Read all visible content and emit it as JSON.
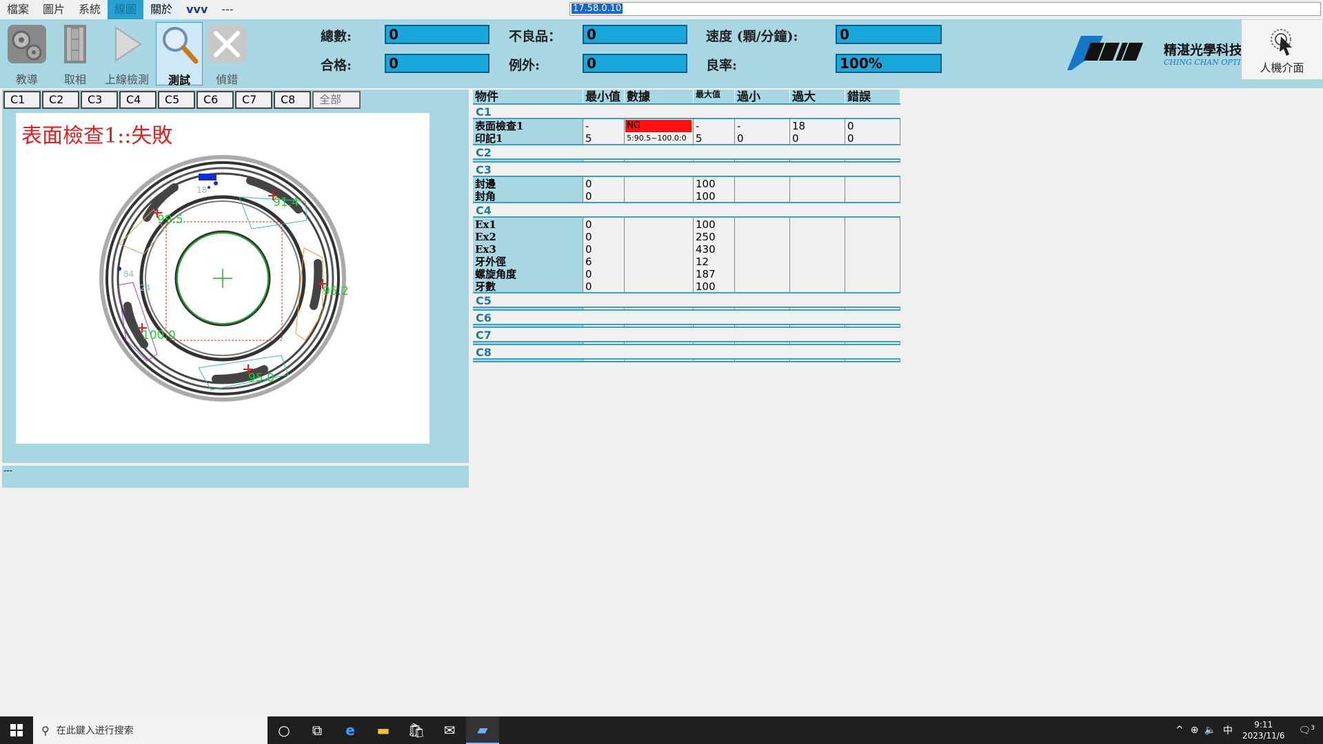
{
  "menu": {
    "items": [
      "檔案",
      "圖片",
      "系統",
      "線圖",
      "關於",
      "vvv",
      "---"
    ],
    "ip_value": "17.58.0.10"
  },
  "toolbar": {
    "buttons": [
      "教導",
      "取相",
      "上線檢測",
      "測試",
      "偵錯"
    ],
    "hmi_label": "人機介面"
  },
  "stats": {
    "total_label": "總數:",
    "total_value": "0",
    "pass_label": "合格:",
    "pass_value": "0",
    "defect_label": "不良品：",
    "defect_value": "0",
    "exception_label": "例外:",
    "exception_value": "0",
    "speed_label": "速度 (顆/分鐘):",
    "speed_value": "0",
    "yield_label": "良率:",
    "yield_value": "100%"
  },
  "logo": {
    "cn_name": "精湛光學科技",
    "en_name": "CHING CHAN OPTICAL"
  },
  "tabs": [
    "C1",
    "C2",
    "C3",
    "C4",
    "C5",
    "C6",
    "C7",
    "C8",
    "全部"
  ],
  "image": {
    "result_text": "表面檢查1::失敗",
    "labels": [
      "91.4",
      "99.5",
      "95.2",
      "100.0",
      "95.0",
      "84",
      "18",
      "24"
    ]
  },
  "status_text": "---",
  "table": {
    "headers": [
      "物件",
      "最小值",
      "數據",
      "最大值",
      "過小",
      "過大",
      "錯誤"
    ],
    "groups": [
      {
        "title": "C1",
        "rows": [
          {
            "name": "表面檢查1",
            "min": "-",
            "data": "NG",
            "max": "-",
            "under": "-",
            "over": "18",
            "err": "0"
          },
          {
            "name": "印記1",
            "min": "5",
            "data": "5:90.5~100.0:0",
            "max": "5",
            "under": "0",
            "over": "0",
            "err": "0"
          }
        ]
      },
      {
        "title": "C2",
        "rows": []
      },
      {
        "title": "C3",
        "rows": [
          {
            "name": "封邊",
            "min": "0",
            "data": "",
            "max": "100",
            "under": "",
            "over": "",
            "err": ""
          },
          {
            "name": "封角",
            "min": "0",
            "data": "",
            "max": "100",
            "under": "",
            "over": "",
            "err": ""
          }
        ]
      },
      {
        "title": "C4",
        "rows": [
          {
            "name": "Ex1",
            "min": "0",
            "data": "",
            "max": "100",
            "under": "",
            "over": "",
            "err": ""
          },
          {
            "name": "Ex2",
            "min": "0",
            "data": "",
            "max": "250",
            "under": "",
            "over": "",
            "err": ""
          },
          {
            "name": "Ex3",
            "min": "0",
            "data": "",
            "max": "430",
            "under": "",
            "over": "",
            "err": ""
          },
          {
            "name": "牙外徑",
            "min": "6",
            "data": "",
            "max": "12",
            "under": "",
            "over": "",
            "err": ""
          },
          {
            "name": "螺旋角度",
            "min": "0",
            "data": "",
            "max": "187",
            "under": "",
            "over": "",
            "err": ""
          },
          {
            "name": "牙數",
            "min": "0",
            "data": "",
            "max": "100",
            "under": "",
            "over": "",
            "err": ""
          }
        ]
      },
      {
        "title": "C5",
        "rows": []
      },
      {
        "title": "C6",
        "rows": []
      },
      {
        "title": "C7",
        "rows": []
      },
      {
        "title": "C8",
        "rows": []
      }
    ]
  },
  "taskbar": {
    "search_placeholder": "在此鍵入进行搜索",
    "time": "9:11",
    "date": "2023/11/6",
    "ime": "中",
    "notifications": "3"
  },
  "colors": {
    "panel": "#a8d6e2",
    "stat_box": "#1aa7dc",
    "ng": "#ff1010",
    "fail_text": "#e02020"
  }
}
